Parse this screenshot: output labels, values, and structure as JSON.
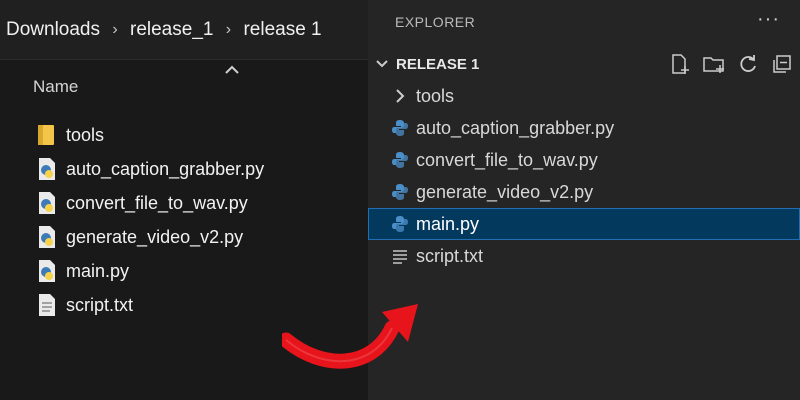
{
  "file_explorer": {
    "breadcrumb": [
      "Downloads",
      "release_1",
      "release 1"
    ],
    "column_header": "Name",
    "files": [
      {
        "name": "tools",
        "icon": "folder-icon"
      },
      {
        "name": "auto_caption_grabber.py",
        "icon": "python-file-icon"
      },
      {
        "name": "convert_file_to_wav.py",
        "icon": "python-file-icon"
      },
      {
        "name": "generate_video_v2.py",
        "icon": "python-file-icon"
      },
      {
        "name": "main.py",
        "icon": "python-file-icon"
      },
      {
        "name": "script.txt",
        "icon": "text-file-icon"
      }
    ]
  },
  "vscode_explorer": {
    "title": "EXPLORER",
    "more_actions": "···",
    "folder_name": "RELEASE 1",
    "tree": [
      {
        "name": "tools",
        "icon": "chevron-right-icon"
      },
      {
        "name": "auto_caption_grabber.py",
        "icon": "python-icon"
      },
      {
        "name": "convert_file_to_wav.py",
        "icon": "python-icon"
      },
      {
        "name": "generate_video_v2.py",
        "icon": "python-icon"
      },
      {
        "name": "main.py",
        "icon": "python-icon",
        "selected": true
      },
      {
        "name": "script.txt",
        "icon": "text-lines-icon"
      }
    ]
  },
  "colors": {
    "selection_bg": "#04395e",
    "selection_border": "#1e6fb3",
    "arrow": "#e8141b",
    "folder_yellow": "#f3c64a",
    "python_blue": "#3d7ab8",
    "python_yellow": "#f7d24a"
  }
}
